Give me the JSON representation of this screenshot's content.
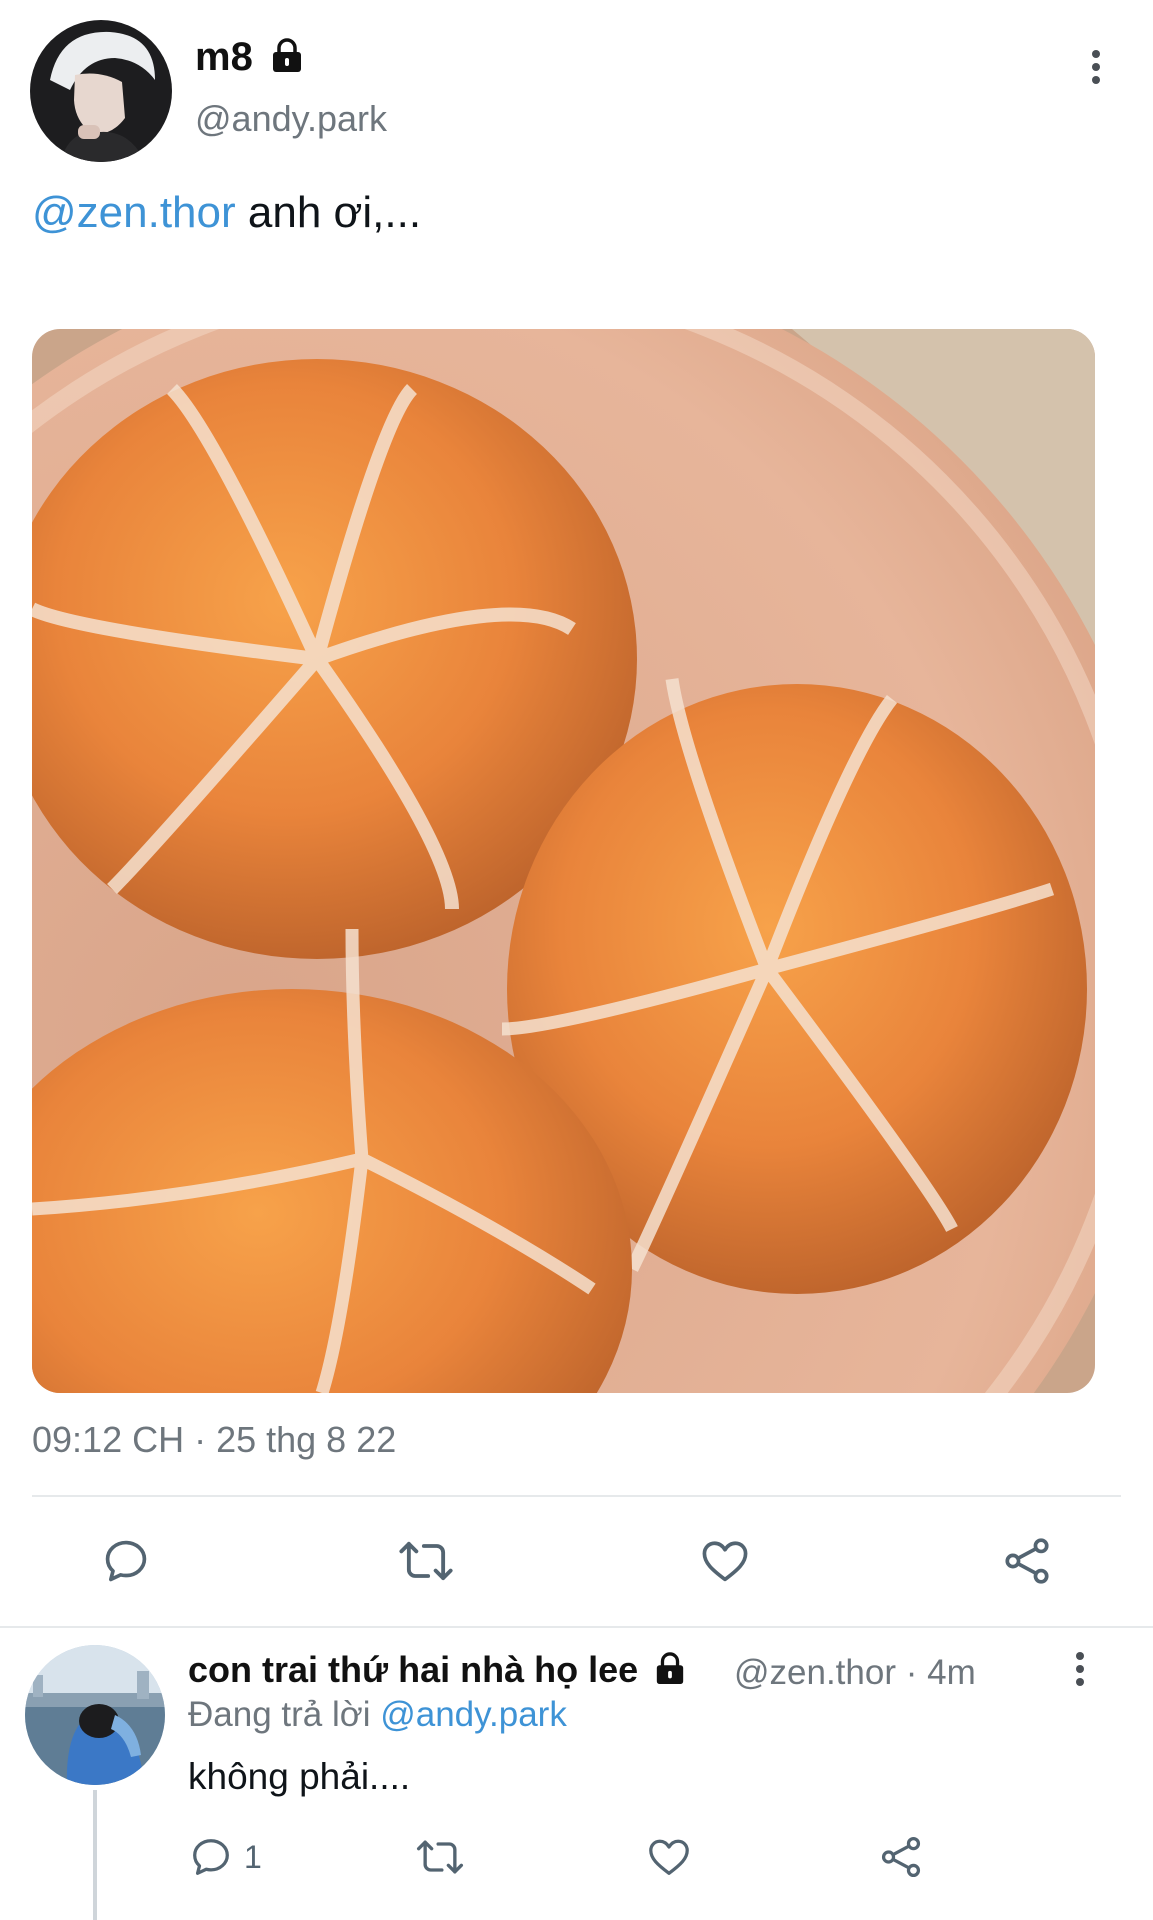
{
  "tweet": {
    "display_name": "m8",
    "handle": "@andy.park",
    "mention": "@zen.thor",
    "text": " anh ơi,...",
    "timestamp": "09:12 CH · 25 thg 8 22",
    "icons": [
      "lock-icon",
      "more-options-icon",
      "reply-icon",
      "retweet-icon",
      "like-icon",
      "share-icon"
    ]
  },
  "reply": {
    "display_name": "con trai thứ hai nhà họ lee",
    "handle": "@zen.thor",
    "time": "4m",
    "replying_prefix": "Đang trả lời ",
    "replying_to": "@andy.park",
    "text": "không phải....",
    "reply_count": "1"
  },
  "colors": {
    "link": "#3e93d6",
    "secondary_text": "#6e767d",
    "divider": "#e6e9eb"
  }
}
